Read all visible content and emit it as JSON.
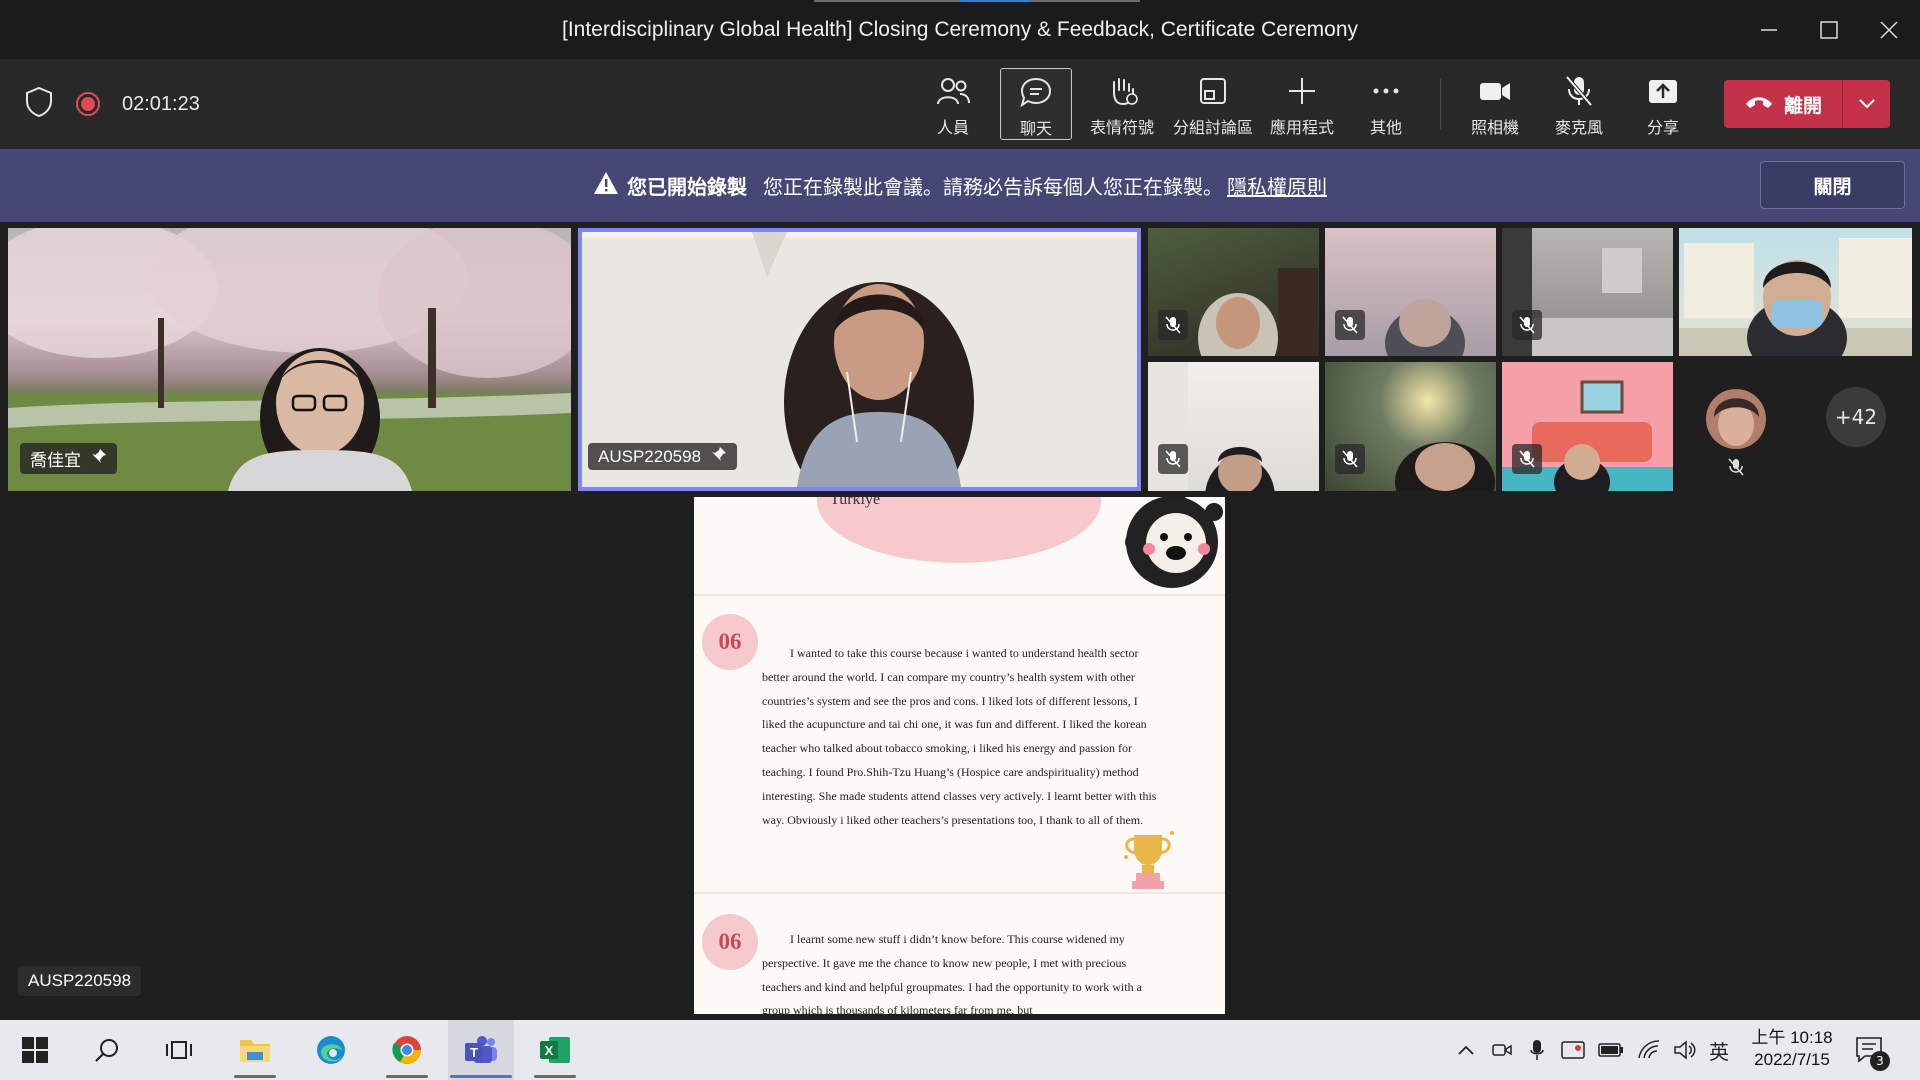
{
  "window": {
    "title": "[Interdisciplinary Global Health] Closing Ceremony & Feedback, Certificate Ceremony"
  },
  "toolbar": {
    "timer": "02:01:23",
    "buttons": {
      "people": "人員",
      "chat": "聊天",
      "reactions": "表情符號",
      "rooms": "分組討論區",
      "apps": "應用程式",
      "more": "其他",
      "camera": "照相機",
      "mic": "麥克風",
      "share": "分享"
    },
    "leave_label": "離開"
  },
  "banner": {
    "bold_text": "您已開始錄製",
    "message": "您正在錄製此會議。請務必告訴每個人您正在錄製。",
    "link_text": "隱私權原則",
    "close_label": "關閉"
  },
  "participants": {
    "pinned_1_name": "喬佳宜",
    "pinned_2_name": "AUSP220598",
    "overflow_count": "+42"
  },
  "shared_content": {
    "presenter_name": "AUSP220598",
    "top_label": "Turkiye",
    "block1_number": "06",
    "block1_text": "I wanted to take this course because i wanted to understand health sector better around the world. I can compare my country’s health system with other countries’s system and see the pros and cons. I liked lots of different lessons, I liked the acupuncture and tai chi one, it was fun and different. I liked the korean teacher who talked about tobacco smoking, i liked his energy and passion for teaching. I found Pro.Shih-Tzu Huang’s (Hospice care andspirituality) method interesting. She made students attend classes very actively. I learnt better with this way. Obviously i liked other teachers’s presentations too, I thank to all of them.",
    "block2_number": "06",
    "block2_text": "I learnt some new stuff i didn’t know before. This course widened my perspective. It gave me the chance to know new people, I met with precious teachers and kind and helpful groupmates. I had the opportunity to work with a group which is thousands of kilometers far from me, but"
  },
  "taskbar": {
    "clock_time": "上午 10:18",
    "clock_date": "2022/7/15",
    "ime": "英",
    "notifications": "3"
  }
}
